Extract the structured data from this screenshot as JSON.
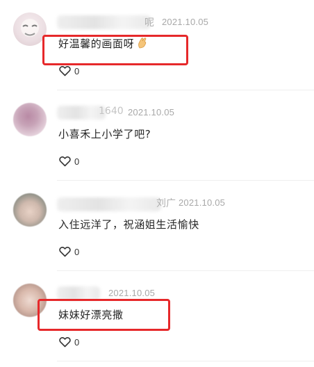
{
  "comments": [
    {
      "name_tail": "呢",
      "date": "2021.10.05",
      "text": "好温馨的画面呀",
      "emoji_icon": "clap-hands-icon",
      "likes": "0",
      "highlighted": true
    },
    {
      "name_tail": "1640",
      "date": "2021.10.05",
      "text": "小喜禾上小学了吧?",
      "likes": "0",
      "highlighted": false
    },
    {
      "name_tail": "刘广",
      "date": "2021.10.05",
      "text": "入住远洋了，祝涵姐生活愉快",
      "likes": "0",
      "highlighted": false
    },
    {
      "name_tail": "",
      "date": "2021.10.05",
      "text": "妹妹好漂亮撒",
      "likes": "0",
      "highlighted": true
    }
  ],
  "colors": {
    "highlight": "#e6282a",
    "date": "#a8a8a8",
    "divider": "#eeeeee"
  }
}
